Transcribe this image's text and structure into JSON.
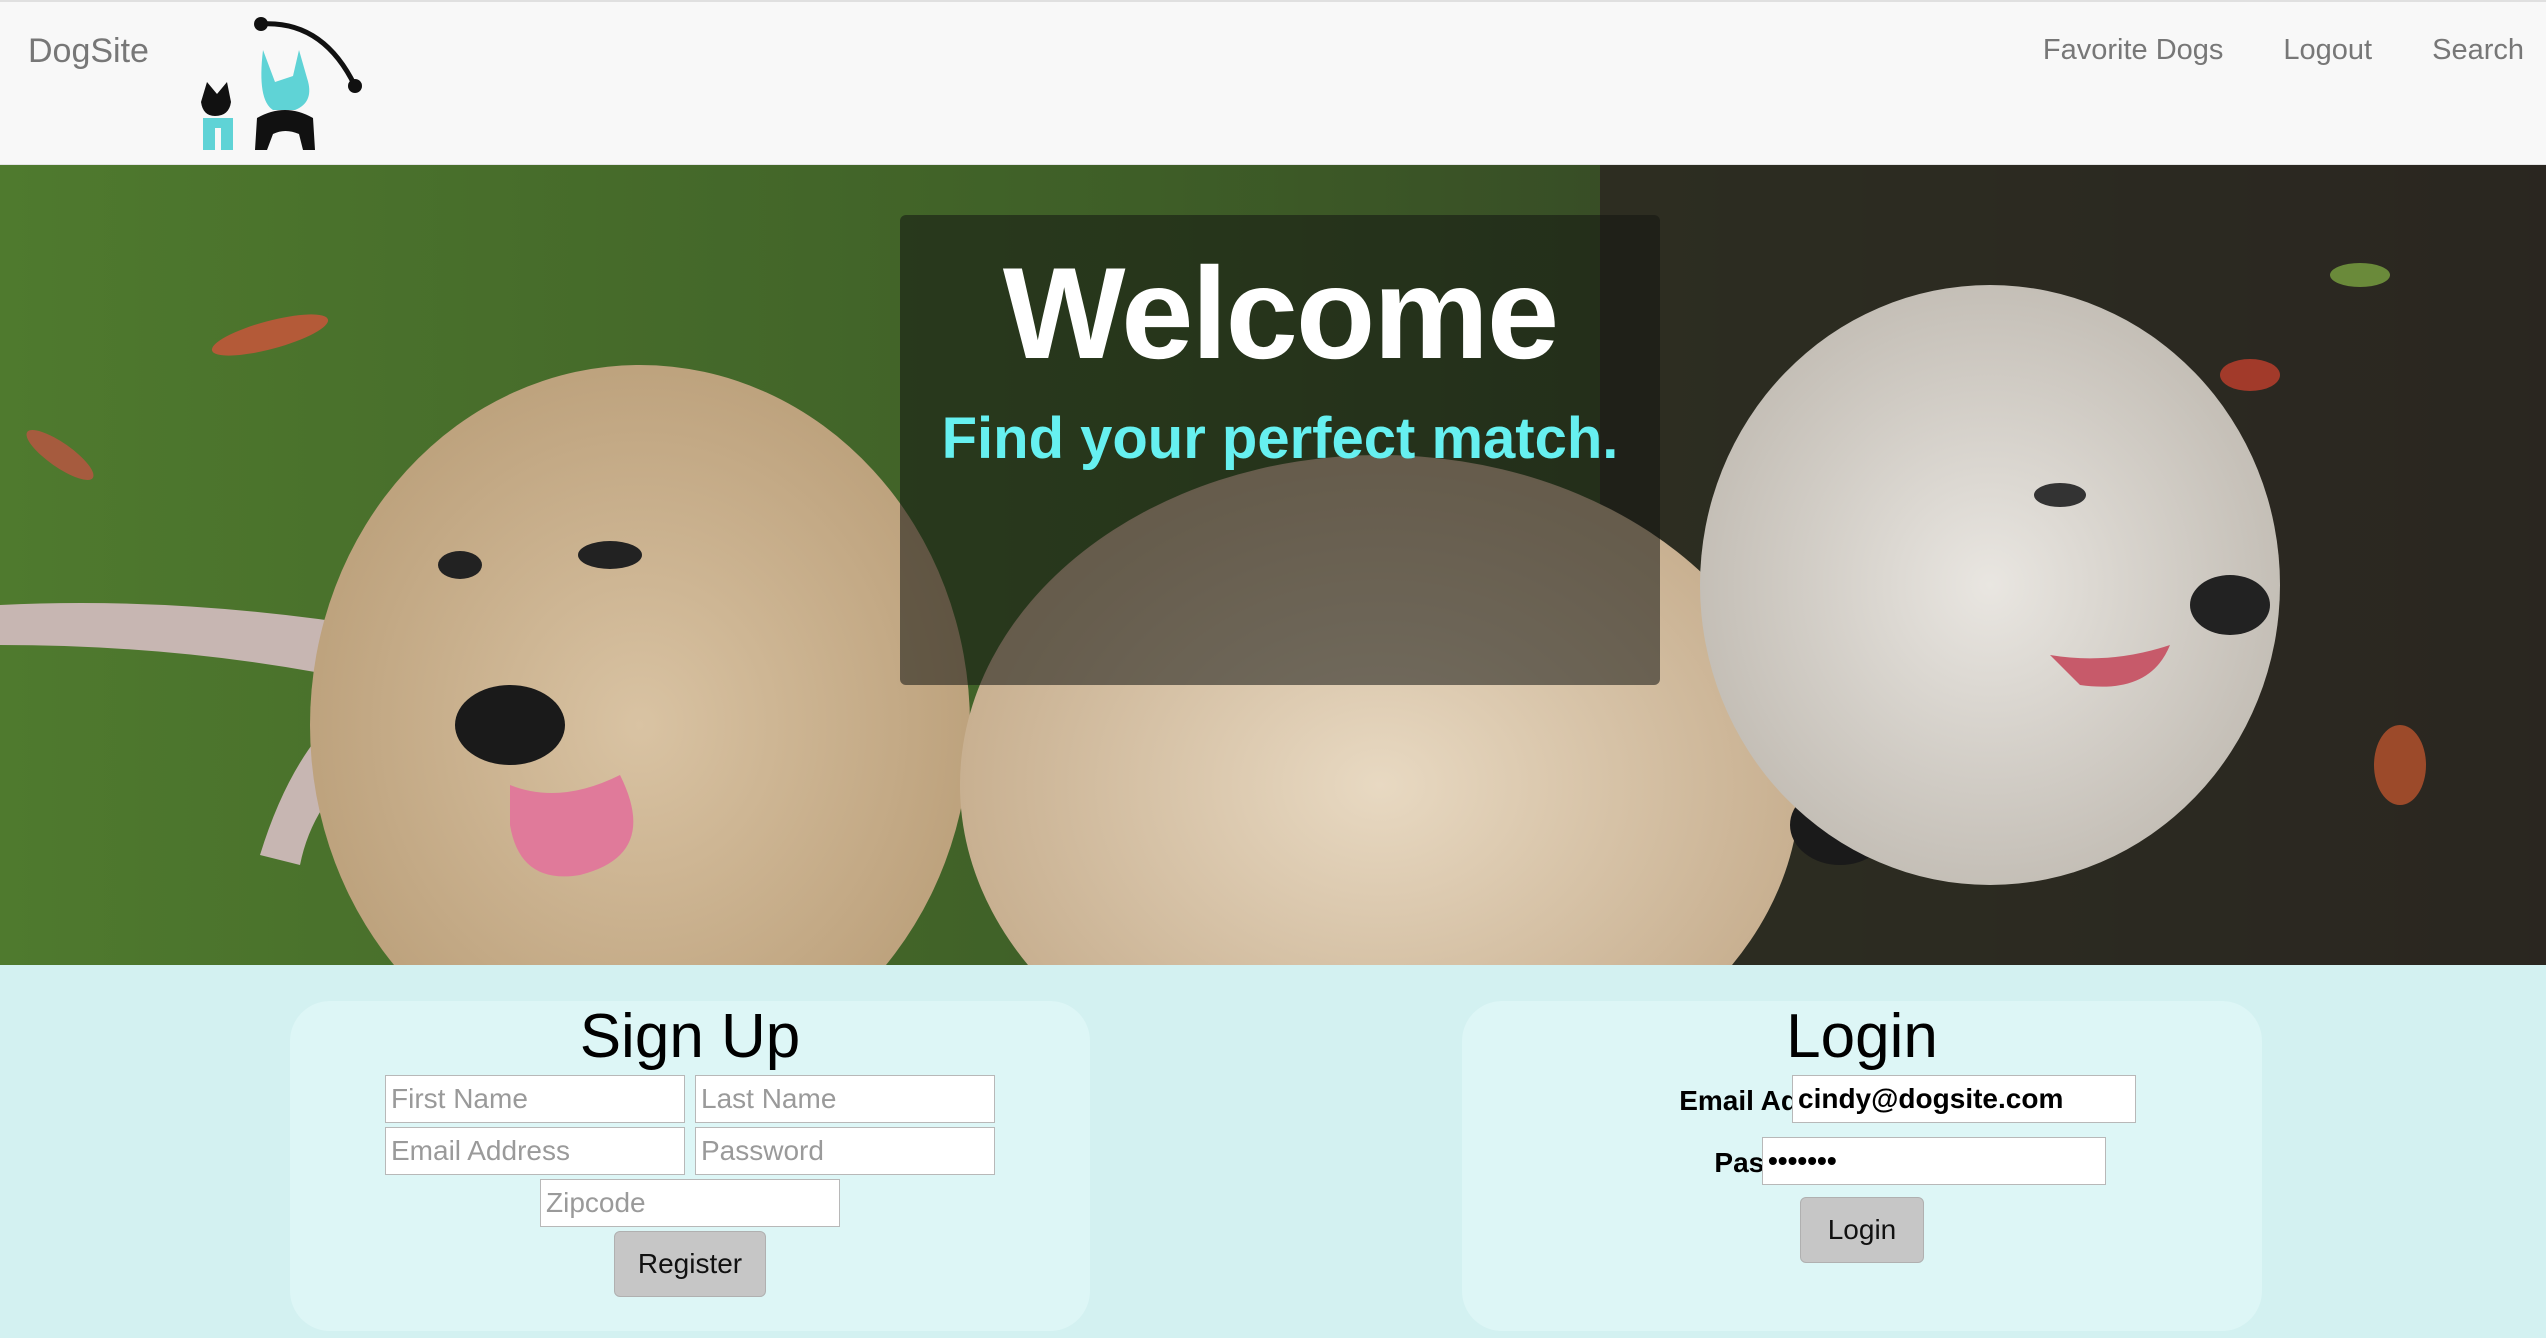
{
  "navbar": {
    "brand": "DogSite",
    "links": [
      "Favorite Dogs",
      "Logout",
      "Search"
    ]
  },
  "hero": {
    "title": "Welcome",
    "subtitle": "Find your perfect match."
  },
  "signup": {
    "title": "Sign Up",
    "first_name_placeholder": "First Name",
    "last_name_placeholder": "Last Name",
    "email_placeholder": "Email Address",
    "password_placeholder": "Password",
    "zipcode_placeholder": "Zipcode",
    "register_label": "Register"
  },
  "login": {
    "title": "Login",
    "email_label": "Email Address:",
    "email_value": "cindy@dogsite.com",
    "password_label": "Password:",
    "password_value": "•••••••",
    "login_label": "Login"
  },
  "colors": {
    "accent": "#66f0f0",
    "logo_teal": "#5fd3d6",
    "form_background": "#d3f1f1"
  },
  "icons": [
    "dog-cat-logo-icon"
  ]
}
